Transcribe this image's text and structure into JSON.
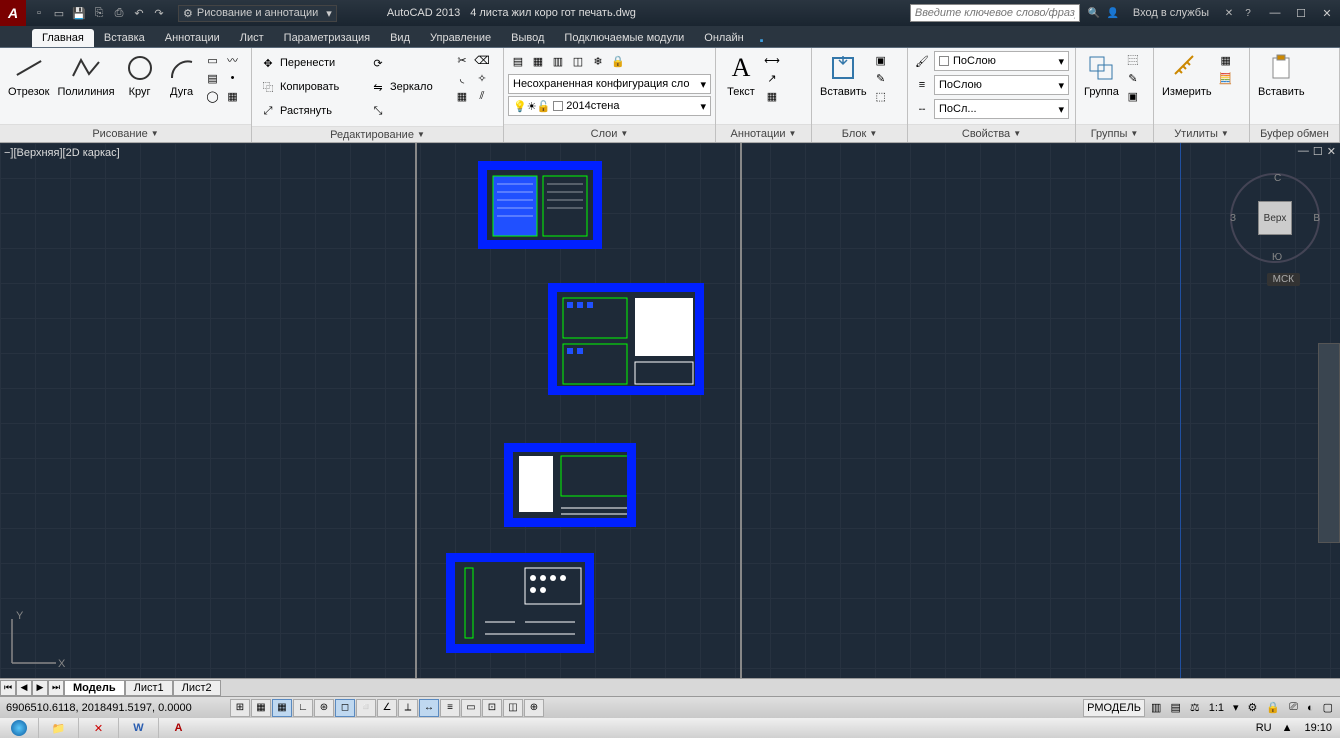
{
  "titlebar": {
    "workspace": "Рисование и аннотации",
    "app": "AutoCAD 2013",
    "doc": "4 листа жил коро гот печать.dwg",
    "search_placeholder": "Введите ключевое слово/фразу",
    "signin": "Вход в службы"
  },
  "tabs": [
    "Главная",
    "Вставка",
    "Аннотации",
    "Лист",
    "Параметризация",
    "Вид",
    "Управление",
    "Вывод",
    "Подключаемые модули",
    "Онлайн"
  ],
  "ribbon": {
    "draw": {
      "title": "Рисование",
      "line": "Отрезок",
      "pline": "Полилиния",
      "circle": "Круг",
      "arc": "Дуга"
    },
    "modify": {
      "title": "Редактирование",
      "move": "Перенести",
      "copy": "Копировать",
      "stretch": "Растянуть",
      "rotate": "",
      "mirror": "Зеркало",
      "scale": ""
    },
    "layers": {
      "title": "Слои",
      "combo1": "Несохраненная конфигурация сло",
      "combo2": "2014стена"
    },
    "annot": {
      "title": "Аннотации",
      "text": "Текст"
    },
    "block": {
      "title": "Блок",
      "insert": "Вставить"
    },
    "props": {
      "title": "Свойства",
      "bylayer": "ПоСлою",
      "linetype": "ПоСлою",
      "lineweight": "ПоСл..."
    },
    "groups": {
      "title": "Группы",
      "group": "Группа"
    },
    "utils": {
      "title": "Утилиты",
      "measure": "Измерить"
    },
    "clip": {
      "title": "Буфер обмен",
      "paste": "Вставить"
    }
  },
  "viewport": {
    "label": "−][Верхняя][2D каркас]"
  },
  "viewcube": {
    "top": "Верх",
    "n": "С",
    "s": "Ю",
    "e": "В",
    "w": "З",
    "wcs": "МСК"
  },
  "mtabs": {
    "model": "Модель",
    "layout1": "Лист1",
    "layout2": "Лист2"
  },
  "status": {
    "coords": "6906510.6118, 2018491.5197, 0.0000",
    "rmodel": "РМОДЕЛЬ",
    "scale": "1:1",
    "lang": "RU",
    "clock": "19:10"
  }
}
